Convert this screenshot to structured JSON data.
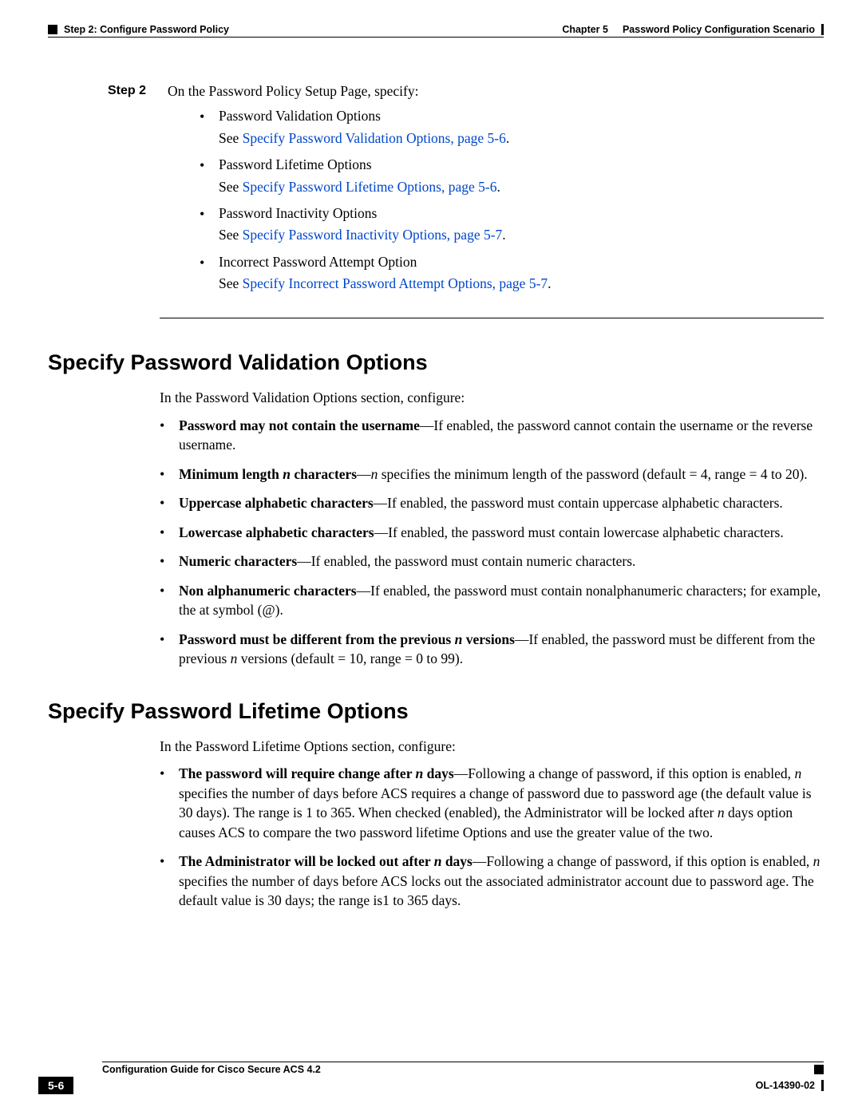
{
  "header": {
    "left": "Step 2: Configure Password Policy",
    "right_chapter": "Chapter 5",
    "right_title": "Password Policy Configuration Scenario"
  },
  "step": {
    "label": "Step 2",
    "intro": "On the Password Policy Setup Page, specify:",
    "items": [
      {
        "title": "Password Validation Options",
        "see_prefix": "See ",
        "link": "Specify Password Validation Options, page 5-6"
      },
      {
        "title": "Password Lifetime Options",
        "see_prefix": "See ",
        "link": "Specify Password Lifetime Options, page 5-6"
      },
      {
        "title": "Password Inactivity Options",
        "see_prefix": "See ",
        "link": "Specify Password Inactivity Options, page 5-7"
      },
      {
        "title": "Incorrect Password Attempt Option",
        "see_prefix": "See ",
        "link": "Specify Incorrect Password Attempt Options, page 5-7"
      }
    ]
  },
  "section1": {
    "heading": "Specify Password Validation Options",
    "intro": "In the Password Validation Options section, configure:",
    "bullets": [
      {
        "bold": "Password may not contain the username",
        "rest": "—If enabled, the password cannot contain the username or the reverse username."
      },
      {
        "bold_pre": "Minimum length ",
        "bold_i": "n",
        "bold_post": " characters",
        "rest_pre": "—",
        "rest_i": "n",
        "rest_post": " specifies the minimum length of the password (default = 4, range = 4 to 20)."
      },
      {
        "bold": "Uppercase alphabetic characters",
        "rest": "—If enabled, the password must contain uppercase alphabetic characters."
      },
      {
        "bold": "Lowercase alphabetic characters",
        "rest": "—If enabled, the password must contain lowercase alphabetic characters."
      },
      {
        "bold": "Numeric characters",
        "rest": "—If enabled, the password must contain numeric characters."
      },
      {
        "bold": "Non alphanumeric characters",
        "rest": "—If enabled, the password must contain nonalphanumeric characters; for example, the at symbol (@)."
      },
      {
        "bold_pre": "Password must be different from the previous ",
        "bold_i": "n",
        "bold_post": " versions",
        "rest_pre": "—If enabled, the password must be different from the previous ",
        "rest_i": "n",
        "rest_post": " versions (default = 10, range = 0 to 99)."
      }
    ]
  },
  "section2": {
    "heading": "Specify Password Lifetime Options",
    "intro": "In the Password Lifetime Options section, configure:",
    "bullets": [
      {
        "bold_pre": "The password will require change after ",
        "bold_i": "n",
        "bold_post": " days",
        "rest_pre": "—Following a change of password, if this option is enabled, ",
        "rest_i": "n",
        "rest_post": " specifies the number of days before ACS requires a change of password due to password age (the default value is 30 days). The range is 1 to 365. When checked (enabled), the Administrator will be locked after ",
        "rest_i2": "n",
        "rest_post2": " days option causes ACS to compare the two password lifetime Options and use the greater value of the two."
      },
      {
        "bold_pre": "The Administrator will be locked out after ",
        "bold_i": "n",
        "bold_post": " days",
        "rest_pre": "—Following a change of password, if this option is enabled, ",
        "rest_i": "n",
        "rest_post": " specifies the number of days before ACS locks out the associated administrator account due to password age. The default value is 30 days; the range is1 to 365 days."
      }
    ]
  },
  "footer": {
    "title": "Configuration Guide for Cisco Secure ACS 4.2",
    "page": "5-6",
    "doc_id": "OL-14390-02"
  }
}
